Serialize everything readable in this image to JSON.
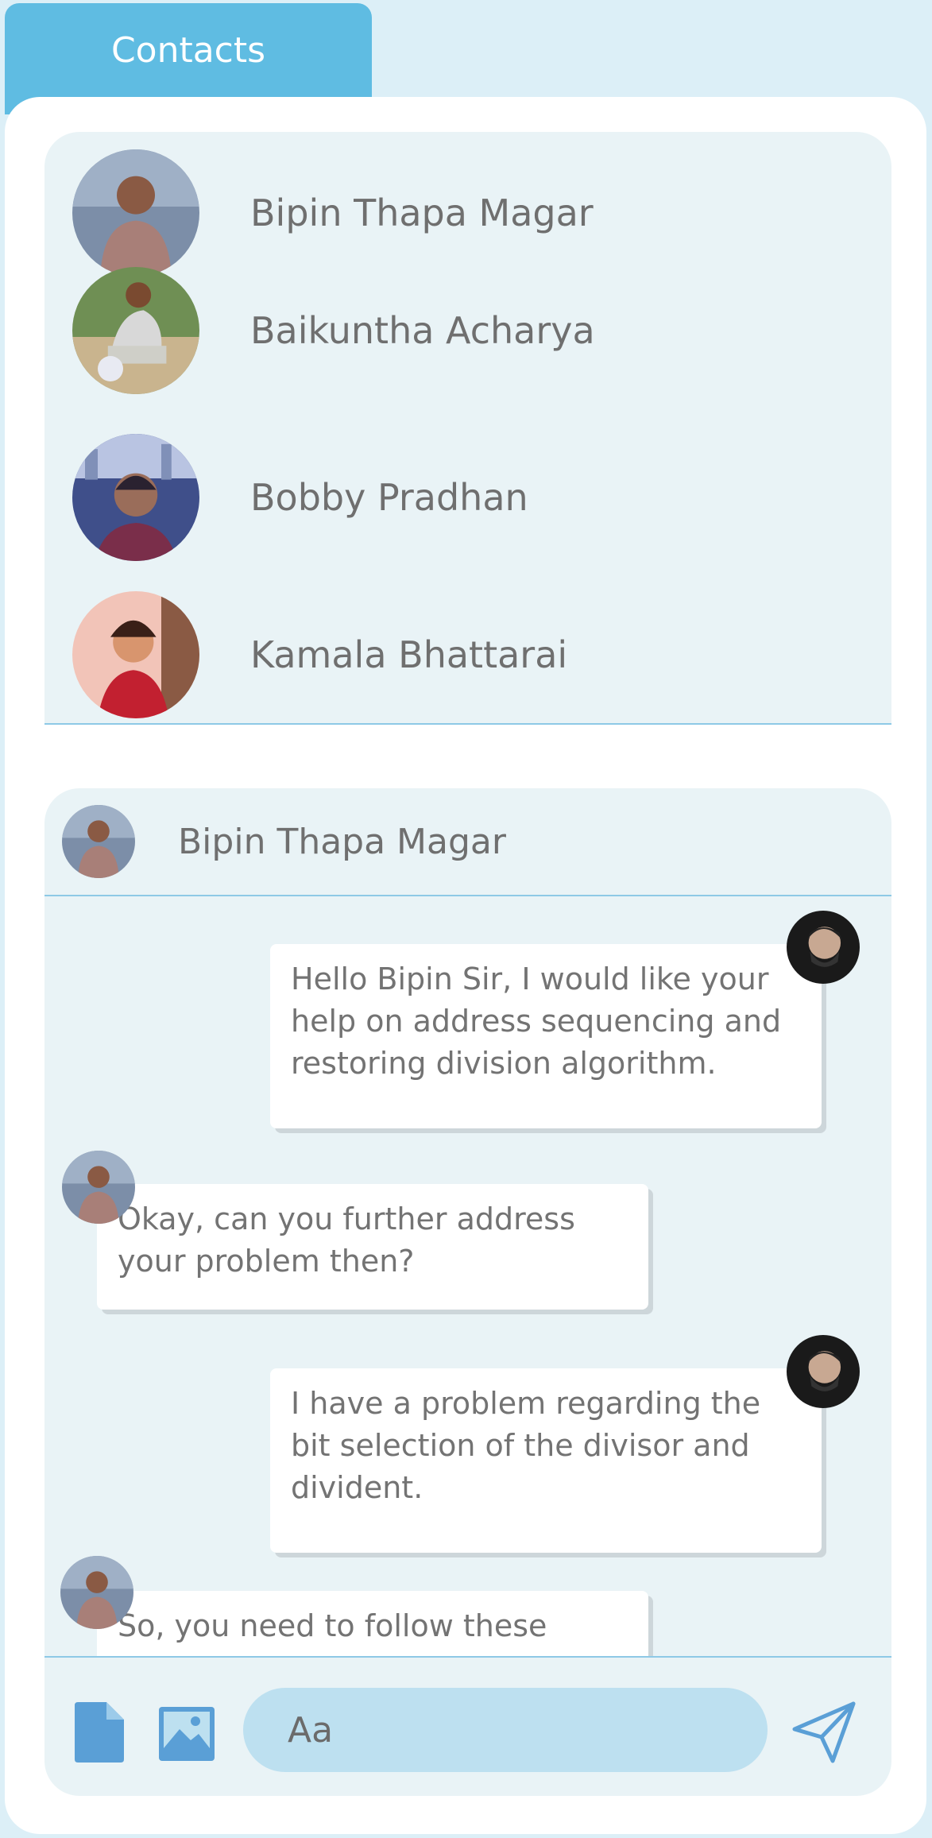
{
  "tab": {
    "label": "Contacts"
  },
  "contacts": [
    {
      "name": "Bipin Thapa Magar"
    },
    {
      "name": "Baikuntha Acharya"
    },
    {
      "name": "Bobby Pradhan"
    },
    {
      "name": "Kamala Bhattarai"
    }
  ],
  "chat": {
    "header_name": "Bipin Thapa Magar",
    "messages": [
      {
        "from": "me",
        "text": "Hello Bipin Sir, I would like your help on address sequencing and restoring division algorithm."
      },
      {
        "from": "contact",
        "text": "Okay, can you further address your problem then?"
      },
      {
        "from": "me",
        "text": "I have a problem regarding the bit selection of the divisor and divident."
      },
      {
        "from": "contact",
        "text": "So, you need to follow these"
      }
    ],
    "input": {
      "placeholder": "Aa",
      "value": ""
    }
  },
  "colors": {
    "accent": "#5fbce2",
    "page_bg": "#dceff7",
    "panel_bg": "#e9f3f6",
    "divider": "#8ec9e6",
    "input_bg": "#bde0f0",
    "icon": "#5a9fd6"
  },
  "icons": {
    "attach": "file-icon",
    "image": "image-icon",
    "send": "send-icon"
  }
}
